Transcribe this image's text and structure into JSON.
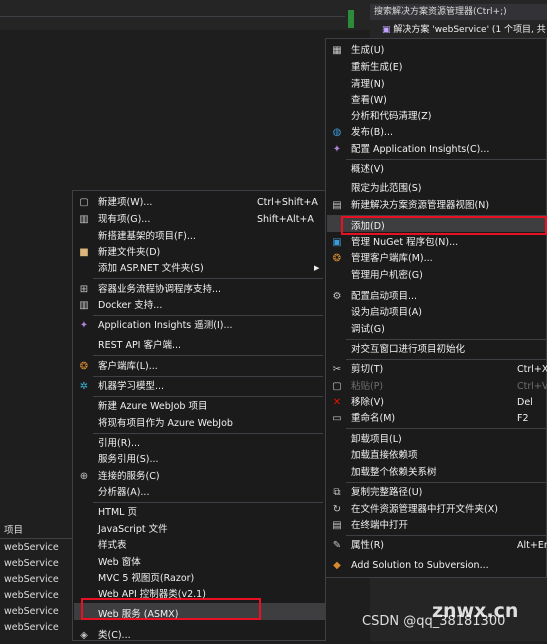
{
  "solution_explorer": {
    "search_placeholder": "搜索解决方案资源管理器(Ctrl+;)",
    "solution_row": "解决方案 'webService' (1 个项目, 共"
  },
  "bottom_panel": {
    "column_header": "项目",
    "rows": [
      "webService",
      "webService",
      "webService",
      "webService",
      "webService",
      "webService",
      "webService"
    ]
  },
  "context_menu": {
    "items": [
      {
        "label": "生成(U)",
        "icon": "build-icon"
      },
      {
        "label": "重新生成(E)"
      },
      {
        "label": "清理(N)"
      },
      {
        "label": "查看(W)"
      },
      {
        "label": "分析和代码清理(Z)"
      },
      {
        "label": "发布(B)...",
        "icon": "globe-icon"
      },
      {
        "label": "配置 Application Insights(C)...",
        "icon": "insights-icon"
      },
      {
        "label": "概述(V)"
      },
      {
        "label": "限定为此范围(S)"
      },
      {
        "label": "新建解决方案资源管理器视图(N)",
        "icon": "new-view-icon"
      },
      {
        "label": "添加(D)"
      },
      {
        "label": "管理 NuGet 程序包(N)...",
        "icon": "nuget-icon"
      },
      {
        "label": "管理客户端库(M)...",
        "icon": "library-icon"
      },
      {
        "label": "管理用户机密(G)"
      },
      {
        "label": "配置启动项目...",
        "icon": "gear-icon"
      },
      {
        "label": "设为启动项目(A)"
      },
      {
        "label": "调试(G)"
      },
      {
        "label": "对交互窗口进行项目初始化"
      },
      {
        "label": "剪切(T)",
        "shortcut": "Ctrl+X",
        "icon": "scissors-icon"
      },
      {
        "label": "粘贴(P)",
        "shortcut": "Ctrl+V",
        "icon": "paste-icon",
        "disabled": true
      },
      {
        "label": "移除(V)",
        "shortcut": "Del",
        "icon": "remove-icon"
      },
      {
        "label": "重命名(M)",
        "shortcut": "F2",
        "icon": "rename-icon"
      },
      {
        "label": "卸载项目(L)"
      },
      {
        "label": "加载直接依赖项"
      },
      {
        "label": "加载整个依赖关系树"
      },
      {
        "label": "复制完整路径(U)",
        "icon": "copy-icon"
      },
      {
        "label": "在文件资源管理器中打开文件夹(X)",
        "icon": "open-folder-icon"
      },
      {
        "label": "在终端中打开",
        "icon": "terminal-icon"
      },
      {
        "label": "属性(R)",
        "shortcut": "Alt+Ent",
        "icon": "wrench-icon"
      },
      {
        "label": "Add Solution to Subversion...",
        "icon": "subversion-icon"
      }
    ]
  },
  "add_submenu": {
    "items": [
      {
        "label": "新建项(W)...",
        "shortcut": "Ctrl+Shift+A",
        "icon": "new-item-icon"
      },
      {
        "label": "现有项(G)...",
        "shortcut": "Shift+Alt+A",
        "icon": "existing-item-icon"
      },
      {
        "label": "新搭建基架的项目(F)..."
      },
      {
        "label": "新建文件夹(D)",
        "icon": "folder-icon"
      },
      {
        "label": "添加 ASP.NET 文件夹(S)"
      },
      {
        "label": "容器业务流程协调程序支持...",
        "icon": "container-icon"
      },
      {
        "label": "Docker 支持...",
        "icon": "docker-icon"
      },
      {
        "label": "Application Insights 遥测(I)...",
        "icon": "insights-icon"
      },
      {
        "label": "REST API 客户端..."
      },
      {
        "label": "客户端库(L)...",
        "icon": "library-icon"
      },
      {
        "label": "机器学习模型...",
        "icon": "ml-icon"
      },
      {
        "label": "新建 Azure WebJob 项目"
      },
      {
        "label": "将现有项目作为 Azure WebJob"
      },
      {
        "label": "引用(R)..."
      },
      {
        "label": "服务引用(S)..."
      },
      {
        "label": "连接的服务(C)",
        "icon": "connected-icon"
      },
      {
        "label": "分析器(A)..."
      },
      {
        "label": "HTML 页"
      },
      {
        "label": "JavaScript 文件"
      },
      {
        "label": "样式表"
      },
      {
        "label": "Web 窗体"
      },
      {
        "label": "MVC 5 视图页(Razor)"
      },
      {
        "label": "Web API 控制器类(v2.1)"
      },
      {
        "label": "Web 服务 (ASMX)"
      },
      {
        "label": "类(C)...",
        "icon": "class-icon"
      }
    ]
  },
  "watermark": {
    "site": "znwx.cn",
    "csdn": "CSDN @qq_38181300"
  },
  "colors": {
    "highlight_border": "#e81123",
    "menu_bg": "#1b1b1c"
  }
}
